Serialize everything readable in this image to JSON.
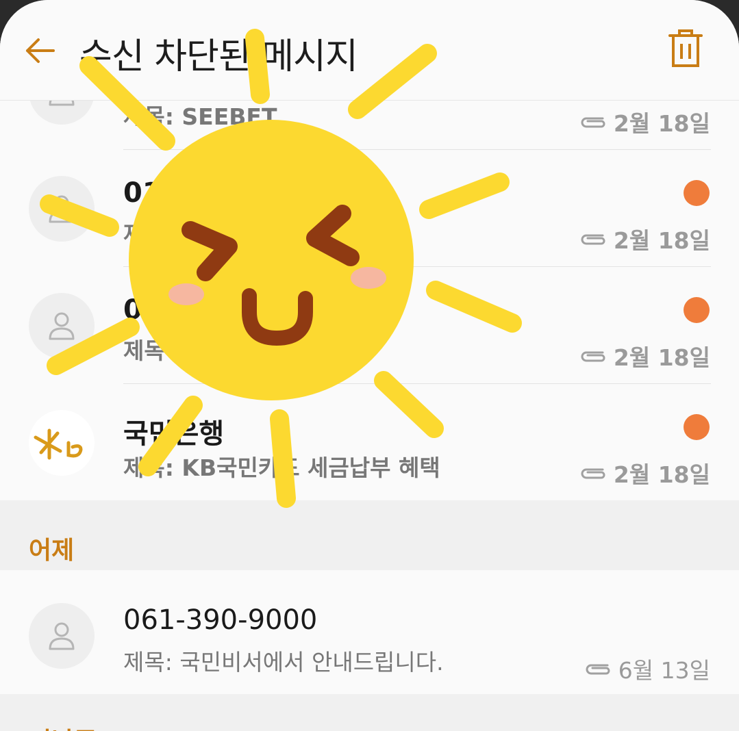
{
  "header": {
    "title": "수신 차단된 메시지"
  },
  "messages_today": [
    {
      "name": "",
      "subject": "제목: SEEBET",
      "date": "2월 18일",
      "unread": false
    },
    {
      "name": "01",
      "subject": "제",
      "date": "2월 18일",
      "unread": true
    },
    {
      "name": "0",
      "subject": "제목",
      "date": "2월 18일",
      "unread": true
    },
    {
      "name": "국민은행",
      "subject": "제목: KB국민카드 세금납부 혜택",
      "date": "2월 18일",
      "unread": true
    }
  ],
  "sections": {
    "yesterday": "어제",
    "next": "지난주"
  },
  "messages_yesterday": [
    {
      "name": "061-390-9000",
      "subject": "제목: 국민비서에서 안내드립니다.",
      "date": "6월 13일",
      "unread": false
    }
  ],
  "colors": {
    "accent": "#c97d15",
    "unread_dot": "#ef7c3b",
    "sun": "#fcd930",
    "sun_face": "#8f3a12"
  },
  "icons": [
    "back-arrow-icon",
    "trash-icon",
    "person-icon",
    "attachment-icon",
    "kb-logo"
  ]
}
